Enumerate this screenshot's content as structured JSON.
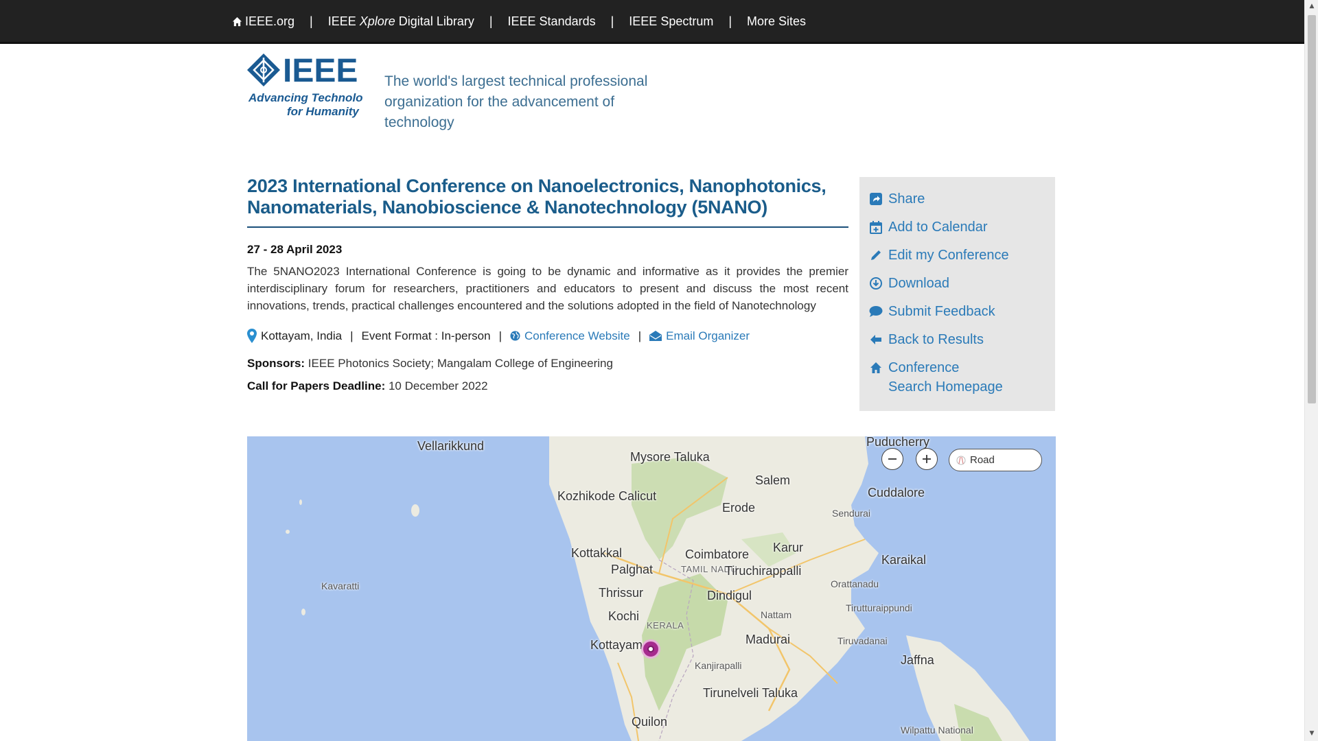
{
  "topnav": {
    "items": [
      "IEEE.org",
      "IEEE Xplore Digital Library",
      "IEEE Standards",
      "IEEE Spectrum",
      "More Sites"
    ],
    "xplore_prefix": "IEEE ",
    "xplore_italic": "Xplore",
    "xplore_suffix": " Digital Library",
    "separator": "|"
  },
  "header": {
    "logo_text": "IEEE",
    "logo_tagline_1": "Advancing Technology",
    "logo_tagline_2": "for Humanity",
    "tagline_line1": "The world's largest technical professional",
    "tagline_line2": "organization for the advancement of technology"
  },
  "conference": {
    "title": "2023 International Conference on Nanoelectronics, Nanophotonics, Nanomaterials, Nanobioscience & Nanotechnology (5NANO)",
    "date": "27 - 28 April 2023",
    "description": "The 5NANO2023 International Conference is going to be dynamic and informative as it provides the premier interdisciplinary forum for researchers, practitioners and educators to present and discuss the most recent innovations, trends, practical challenges encountered and the solutions adopted in the field of Nanotechnology",
    "location": "Kottayam, India",
    "event_format": "Event Format : In-person",
    "website_link": "Conference Website",
    "email_link": "Email Organizer",
    "sponsors_label": "Sponsors:",
    "sponsors_value": "IEEE Photonics Society; Mangalam College of Engineering",
    "cfp_label": "Call for Papers Deadline:",
    "cfp_value": "10 December 2022"
  },
  "sidebar": {
    "items": [
      {
        "label": "Share",
        "icon": "share-icon"
      },
      {
        "label": "Add to Calendar",
        "icon": "calendar-plus-icon"
      },
      {
        "label": "Edit my Conference",
        "icon": "pencil-icon"
      },
      {
        "label": "Download",
        "icon": "download-icon"
      },
      {
        "label": "Submit Feedback",
        "icon": "comment-icon"
      },
      {
        "label": "Back to Results",
        "icon": "arrow-left-icon"
      },
      {
        "label": "Conference Search Homepage",
        "icon": "home-icon"
      }
    ]
  },
  "map": {
    "style_button": "Road",
    "labels": [
      "Vellarikkund",
      "Mysore Taluka",
      "Puducherry",
      "Salem",
      "Cuddalore",
      "Kozhikode Calicut",
      "Erode",
      "Sendurai",
      "Kottakkal",
      "Coimbatore",
      "Karur",
      "Karaikal",
      "Palghat",
      "TAMIL NADU",
      "Tiruchirappalli",
      "Orattanadu",
      "Kavaratti",
      "Thrissur",
      "Dindigul",
      "Tirutturaippundi",
      "Kochi",
      "KERALA",
      "Nattam",
      "Kottayam",
      "Madurai",
      "Tiruvadanai",
      "Kanjirapalli",
      "Jaffna",
      "Tirunelveli Taluka",
      "Quilon",
      "Wilpattu National"
    ]
  }
}
